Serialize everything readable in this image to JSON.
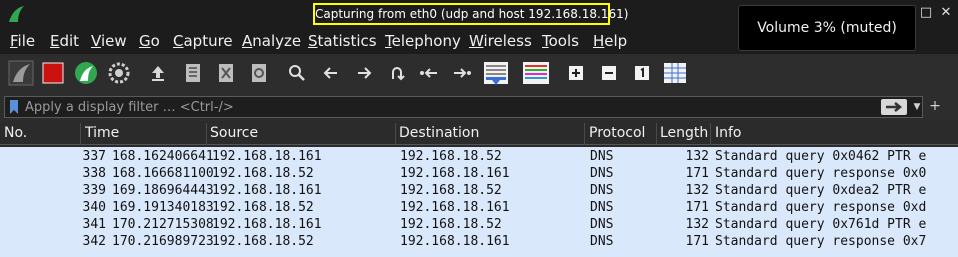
{
  "window": {
    "capture_title": "Capturing from eth0 (udp and host 192.168.18.161)"
  },
  "osd": {
    "text": "Volume 3% (muted)"
  },
  "menu": [
    "File",
    "Edit",
    "View",
    "Go",
    "Capture",
    "Analyze",
    "Statistics",
    "Telephony",
    "Wireless",
    "Tools",
    "Help"
  ],
  "toolbar": {
    "icons": [
      "shark-fin-start-icon",
      "stop-square-icon",
      "shark-fin-restart-icon",
      "gear-options-icon",
      "open-file-icon",
      "save-file-icon",
      "close-file-icon",
      "reload-file-icon",
      "search-icon",
      "back-arrow-icon",
      "forward-arrow-icon",
      "go-to-packet-icon",
      "first-packet-icon",
      "last-packet-icon",
      "auto-scroll-icon",
      "colorize-icon",
      "zoom-in-icon",
      "zoom-out-icon",
      "normal-size-icon",
      "resize-columns-icon"
    ]
  },
  "filter": {
    "placeholder": "Apply a display filter … <Ctrl-/>"
  },
  "columns": {
    "no": "No.",
    "time": "Time",
    "source": "Source",
    "destination": "Destination",
    "protocol": "Protocol",
    "length": "Length",
    "info": "Info"
  },
  "packets": [
    {
      "no": "337",
      "time": "168.162406641",
      "source": "192.168.18.161",
      "destination": "192.168.18.52",
      "protocol": "DNS",
      "length": "132",
      "info": "Standard query 0x0462 PTR e"
    },
    {
      "no": "338",
      "time": "168.166681100",
      "source": "192.168.18.52",
      "destination": "192.168.18.161",
      "protocol": "DNS",
      "length": "171",
      "info": "Standard query response 0x0"
    },
    {
      "no": "339",
      "time": "169.186964443",
      "source": "192.168.18.161",
      "destination": "192.168.18.52",
      "protocol": "DNS",
      "length": "132",
      "info": "Standard query 0xdea2 PTR e"
    },
    {
      "no": "340",
      "time": "169.191340183",
      "source": "192.168.18.52",
      "destination": "192.168.18.161",
      "protocol": "DNS",
      "length": "171",
      "info": "Standard query response 0xd"
    },
    {
      "no": "341",
      "time": "170.212715308",
      "source": "192.168.18.161",
      "destination": "192.168.18.52",
      "protocol": "DNS",
      "length": "132",
      "info": "Standard query 0x761d PTR e"
    },
    {
      "no": "342",
      "time": "170.216989723",
      "source": "192.168.18.52",
      "destination": "192.168.18.161",
      "protocol": "DNS",
      "length": "171",
      "info": "Standard query response 0x7"
    }
  ],
  "colors": {
    "row_bg": "#dae8fb",
    "highlight": "#ffff00",
    "stop": "#cc1111",
    "shark_fin": "#2fa84f"
  }
}
